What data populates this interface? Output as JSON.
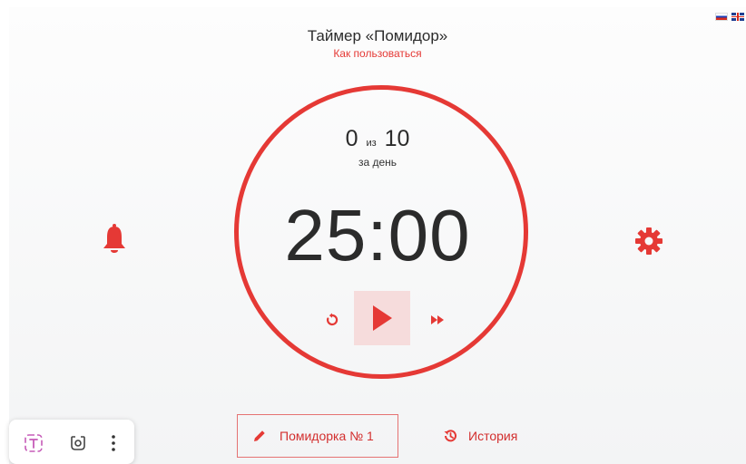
{
  "header": {
    "title": "Таймер «Помидор»",
    "how_to_link": "Как пользоваться"
  },
  "languages": [
    "ru-flag-icon",
    "uk-flag-icon"
  ],
  "counter": {
    "done": "0",
    "of_label": "из",
    "total": "10",
    "period_label": "за день"
  },
  "timer": {
    "time": "25:00",
    "icons": {
      "reset": "reset-icon",
      "play": "play-icon",
      "skip": "skip-forward-icon"
    }
  },
  "side_icons": {
    "left": "bell-icon",
    "right": "gear-icon"
  },
  "footer": {
    "task_label": "Помидорка № 1",
    "task_icon": "pencil-icon",
    "history_label": "История",
    "history_icon": "history-icon"
  },
  "floating_toolbar": {
    "icons": [
      "text-select-icon",
      "lens-search-icon",
      "more-vertical-icon"
    ]
  },
  "colors": {
    "accent": "#e53935",
    "play_bg": "#f6dcdc",
    "text": "#2b2b2b"
  }
}
